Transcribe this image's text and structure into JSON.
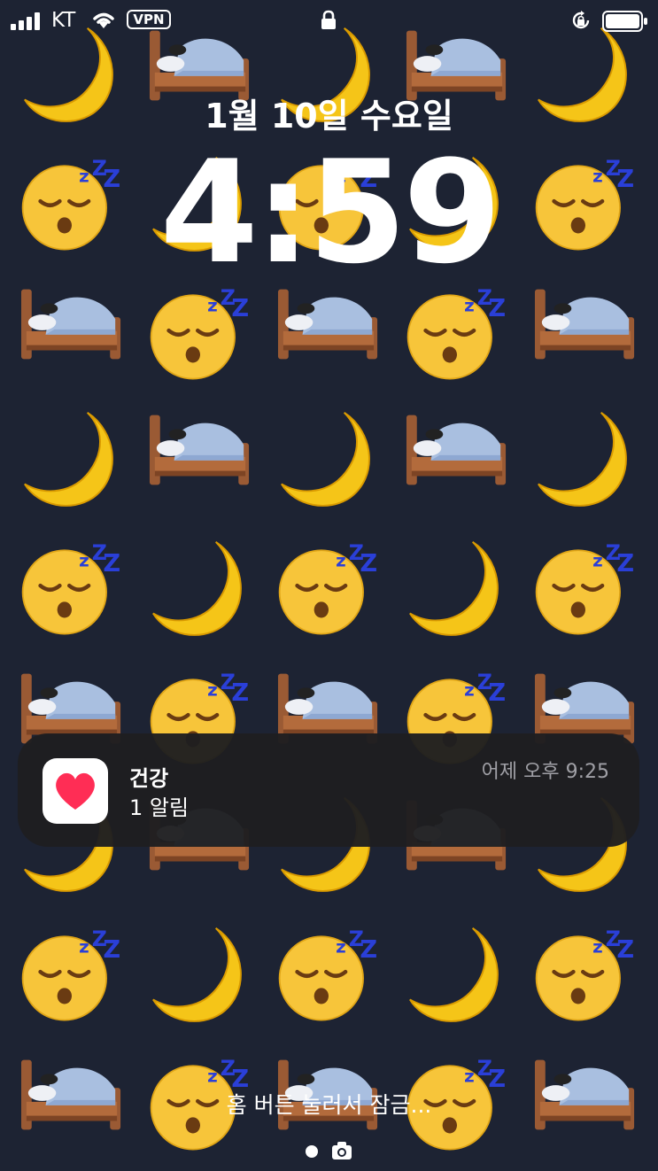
{
  "status_bar": {
    "carrier": "KT",
    "vpn_label": "VPN",
    "signal_icon": "signal-bars-icon",
    "wifi_icon": "wifi-icon",
    "lock_icon": "padlock-icon",
    "rotation_lock_icon": "rotation-lock-icon",
    "battery_icon": "battery-icon"
  },
  "lock_screen": {
    "date": "1월 10일 수요일",
    "time": "4:59",
    "wallpaper_pattern": [
      "crescent-moon-emoji",
      "bed-emoji",
      "sleeping-face-emoji"
    ]
  },
  "notification": {
    "app_name": "건강",
    "message": "1 알림",
    "timestamp": "어제 오후 9:25",
    "app_icon": "health-heart-icon",
    "heart_color": "#ff2d55"
  },
  "bottom": {
    "unlock_hint": "홈 버튼 눌러서 잠금...",
    "page_indicator_icon": "page-dot-icon",
    "camera_icon": "camera-icon"
  },
  "colors": {
    "background": "#1d2333",
    "moon": "#f5c518",
    "face": "#f7c53a",
    "bed_blanket": "#a9bfe0",
    "bed_wood": "#9a5a34",
    "zzz": "#2a3fd8"
  }
}
